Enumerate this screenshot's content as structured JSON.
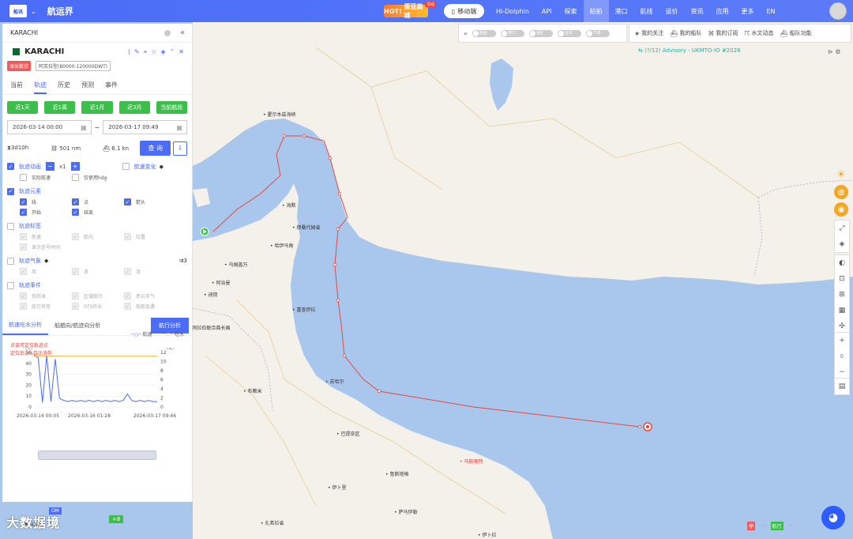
{
  "nav": {
    "app_name": "航运界",
    "hot": "HOT!",
    "hot_sub": "蛋豆商城",
    "mobile": "移动端",
    "items": [
      "Hi-Dolphin",
      "API",
      "探索",
      "船舶",
      "港口",
      "航线",
      "运价",
      "资讯",
      "应用",
      "更多",
      "EN"
    ],
    "active_index": 3
  },
  "search": {
    "value": "KARACHI"
  },
  "ship": {
    "name": "KARACHI",
    "tag_type": "液体散货",
    "tag_class": "阿芙拉型(80000-120000DWT)"
  },
  "tabs": [
    "当前",
    "轨迹",
    "历史",
    "预测",
    "事件"
  ],
  "range_buttons": [
    "近1天",
    "近1周",
    "近1月",
    "近3月",
    "当前航段"
  ],
  "date_from": "2026-03-14 00:00",
  "date_to": "2026-03-17 09:49",
  "stats": {
    "duration": "3d10h",
    "distance": "501 nm",
    "speed": "6.1 kn"
  },
  "query_label": "查 询",
  "sections": {
    "anim": {
      "label": "轨迹动画",
      "speed": "x1",
      "speed_change": "航速变化",
      "opt1": "实际航速",
      "opt2": "仅使用hdg"
    },
    "elements": {
      "label": "轨迹元素",
      "items": [
        "线",
        "点",
        "箭头",
        "开始",
        "结束"
      ]
    },
    "marks": {
      "label": "轨迹标签",
      "items": [
        "航速",
        "航向",
        "位置",
        "显示信号时间"
      ]
    },
    "weather": {
      "label": "轨迹气象",
      "items": [
        "风",
        "浪",
        "流"
      ]
    },
    "events": {
      "label": "轨迹事件",
      "items": [
        "危险海",
        "区域航行",
        "恶劣天气",
        "航行异常",
        "STS作业",
        "船舶会遇"
      ]
    }
  },
  "analysis": {
    "tab1": "航速吃水分析",
    "tab2": "船艏向/航迹向分析",
    "tab3": "航行分析"
  },
  "hint": [
    "点击可定位轨迹点",
    "定位后10s自动消失"
  ],
  "legend": {
    "speed": "航速",
    "draught": "吃水"
  },
  "chart_data": {
    "type": "line",
    "title": "",
    "x": [
      "2026-03-14 00:05",
      "2026-03-16 01:28",
      "2026-03-17 09:46"
    ],
    "ylabel_left": "(节)",
    "ylabel_right": "(米)",
    "ylim_left": [
      0,
      50
    ],
    "ylim_right": [
      0,
      12
    ],
    "left_ticks": [
      0,
      10,
      20,
      30,
      40,
      50
    ],
    "right_ticks": [
      0,
      2,
      4,
      6,
      8,
      10,
      12
    ],
    "series": [
      {
        "name": "航速",
        "color": "#4a6cf7",
        "values": [
          48,
          45,
          4,
          47,
          5,
          44,
          8,
          6,
          5,
          6,
          5,
          6,
          5,
          6,
          5,
          6,
          5,
          6,
          5,
          6,
          5,
          6,
          12,
          6,
          5,
          6,
          5,
          6,
          5,
          5
        ]
      },
      {
        "name": "吃水",
        "color": "#f5b942",
        "values": [
          11.2,
          11.2,
          11.2,
          11.2,
          11.2,
          11.2,
          11.2,
          11.2,
          11.2,
          11.2
        ]
      }
    ]
  },
  "toggles": [
    "船舶",
    "港口",
    "海区",
    "台风",
    "气象"
  ],
  "fleet": [
    "我的关注",
    "我的船队",
    "我的订阅",
    "水文动态",
    "船队功能"
  ],
  "advisory": "(?/12) Advisory - UKMTO-IO #2026",
  "side_numbers": {
    "zoom": "6"
  },
  "map_labels": [
    {
      "t": "霍尔木兹海峡",
      "x": 333,
      "y": 140
    },
    {
      "t": "海默",
      "x": 357,
      "y": 255
    },
    {
      "t": "哈伊马角",
      "x": 342,
      "y": 306
    },
    {
      "t": "穆桑代姆省",
      "x": 370,
      "y": 283
    },
    {
      "t": "乌姆盖万",
      "x": 284,
      "y": 330
    },
    {
      "t": "阿治曼",
      "x": 268,
      "y": 353
    },
    {
      "t": "迪拜",
      "x": 258,
      "y": 368
    },
    {
      "t": "阿拉伯联合酋长国",
      "x": 238,
      "y": 410
    },
    {
      "t": "富查伊拉",
      "x": 370,
      "y": 387
    },
    {
      "t": "苏哈尔",
      "x": 412,
      "y": 478
    },
    {
      "t": "布赖米",
      "x": 308,
      "y": 490
    },
    {
      "t": "巴提奈区",
      "x": 426,
      "y": 544
    },
    {
      "t": "马斯喀特",
      "x": 582,
      "y": 579,
      "red": true
    },
    {
      "t": "鲁斯塔格",
      "x": 488,
      "y": 595
    },
    {
      "t": "伊卜里",
      "x": 415,
      "y": 612
    },
    {
      "t": "萨马伊勒",
      "x": 499,
      "y": 643
    },
    {
      "t": "扎希拉省",
      "x": 330,
      "y": 657
    },
    {
      "t": "伊卜拉",
      "x": 605,
      "y": 672
    }
  ],
  "brand": "大数据境",
  "dm": "DM",
  "plus": "+8",
  "count": "482",
  "map_legend": [
    "停",
    "航行"
  ]
}
